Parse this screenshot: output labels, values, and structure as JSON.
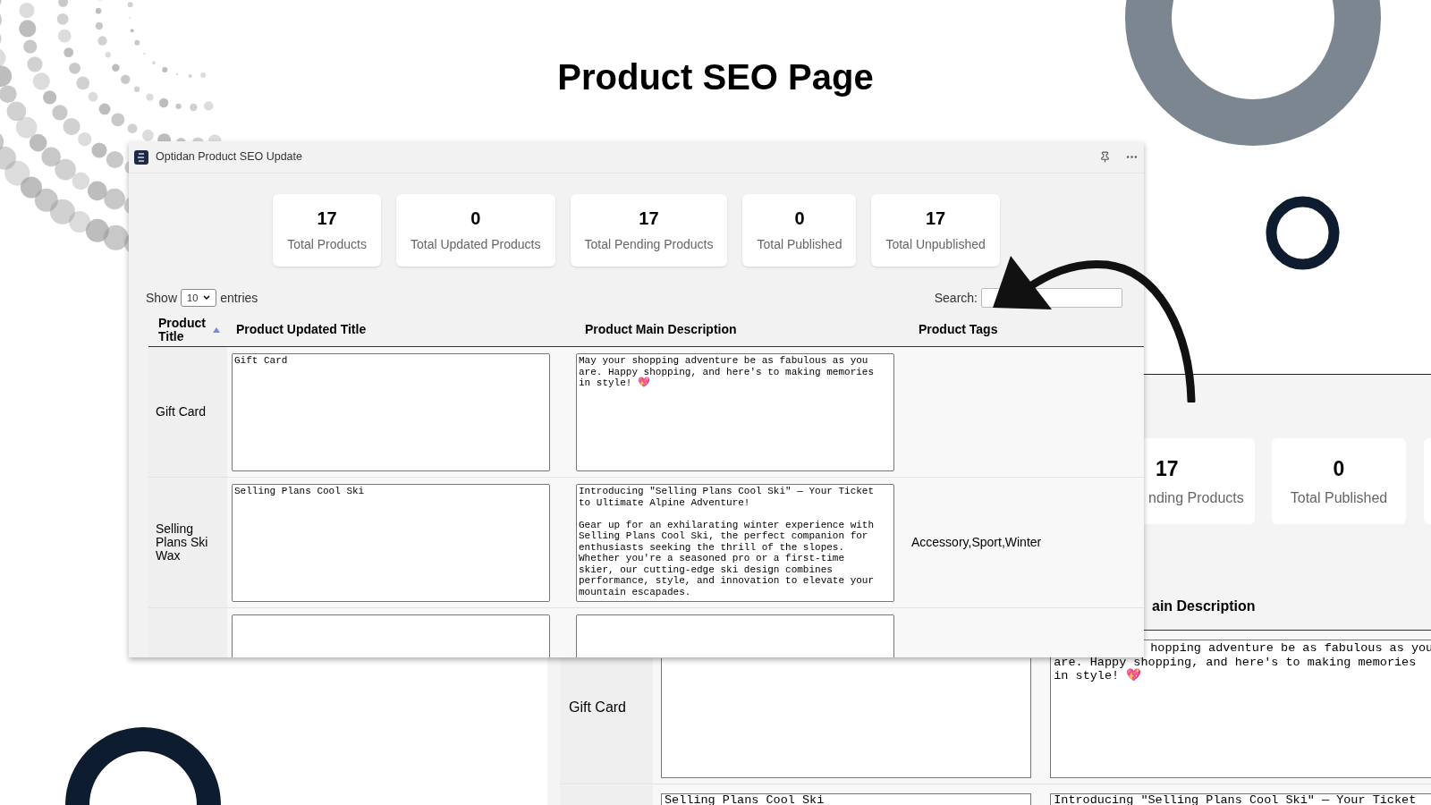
{
  "title": "Product SEO Page",
  "window": {
    "title": "Optidan Product SEO Update",
    "stats": [
      {
        "value": "17",
        "label": "Total Products"
      },
      {
        "value": "0",
        "label": "Total Updated Products"
      },
      {
        "value": "17",
        "label": "Total Pending Products"
      },
      {
        "value": "0",
        "label": "Total Published"
      },
      {
        "value": "17",
        "label": "Total Unpublished"
      }
    ],
    "show_label": "Show",
    "entries_value": "10",
    "entries_label": "entries",
    "search_label": "Search:",
    "columns": [
      {
        "label": "Product Title",
        "sorted": true
      },
      {
        "label": "Product Updated Title"
      },
      {
        "label": "Product Main Description"
      },
      {
        "label": "Product Tags"
      }
    ],
    "rows": [
      {
        "title": "Gift Card",
        "updated_title": "Gift Card",
        "description": "May your shopping adventure be as fabulous as you are. Happy shopping, and here's to making memories in style! 💖"
      },
      {
        "title": "Selling Plans Ski Wax",
        "updated_title": "Selling Plans Cool Ski",
        "description": "Introducing \"Selling Plans Cool Ski\" — Your Ticket to Ultimate Alpine Adventure!\n\nGear up for an exhilarating winter experience with Selling Plans Cool Ski, the perfect companion for enthusiasts seeking the thrill of the slopes. Whether you're a seasoned pro or a first-time skier, our cutting-edge ski design combines performance, style, and innovation to elevate your mountain escapades.",
        "tags": "Accessory,Sport,Winter"
      },
      {}
    ]
  },
  "background_screenshot": {
    "stats": [
      {
        "value": "17",
        "label": "nding Products"
      },
      {
        "value": "0",
        "label": "Total Published"
      }
    ],
    "column_heading": "ain Description",
    "rows": [
      {
        "title": "Gift Card",
        "description_lines": [
          "hopping adventure be as fabulous as you",
          "are. Happy shopping, and here's to making memories",
          "in style! 💖"
        ]
      },
      {
        "updated_title": "Selling Plans Cool Ski",
        "description": "Introducing \"Selling Plans Cool Ski\" — Your Ticket"
      }
    ]
  }
}
